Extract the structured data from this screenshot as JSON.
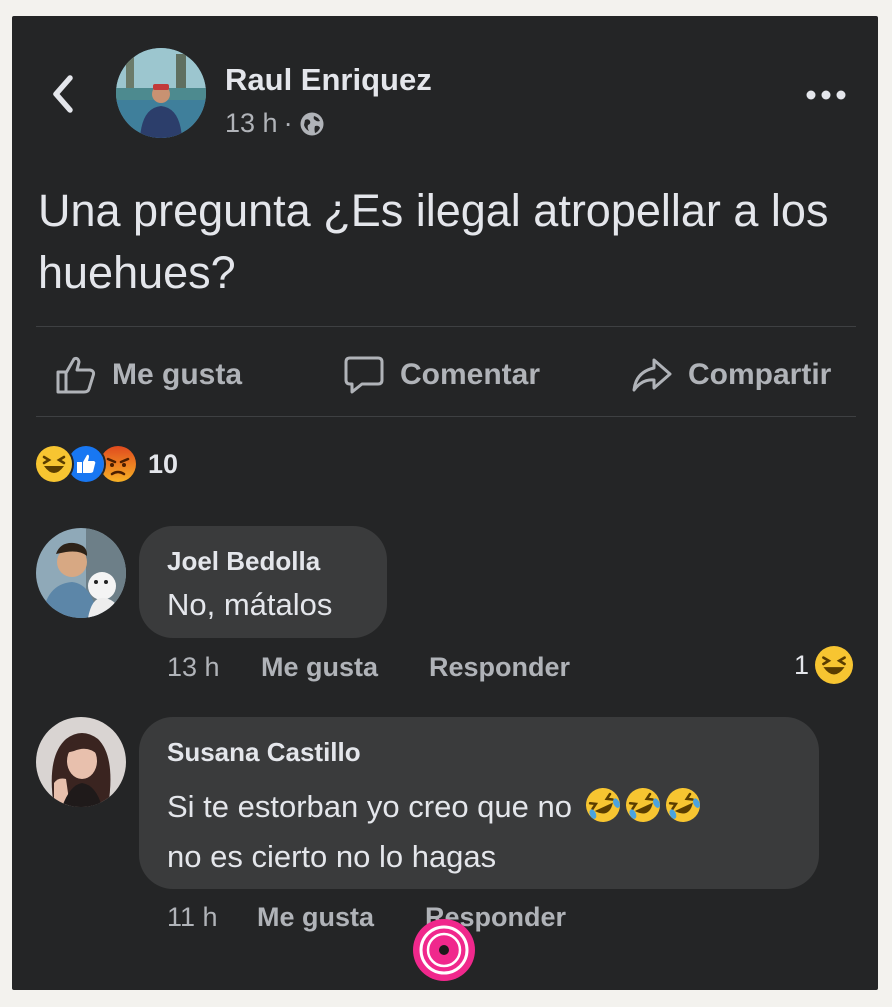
{
  "post": {
    "author": "Raul Enriquez",
    "time": "13 h",
    "separator": "·",
    "text": "Una pregunta ¿Es ilegal atropellar a los huehues?",
    "reaction_count": "10"
  },
  "actions": {
    "like": "Me gusta",
    "comment": "Comentar",
    "share": "Compartir"
  },
  "comments": [
    {
      "name": "Joel Bedolla",
      "text": "No, mátalos",
      "time": "13 h",
      "like": "Me gusta",
      "reply": "Responder",
      "reaction_count": "1"
    },
    {
      "name": "Susana Castillo",
      "text_line1": "Si te estorban yo creo que no",
      "text_line2": "no es cierto no lo hagas",
      "time": "11 h",
      "like": "Me gusta",
      "reply": "Responder"
    }
  ],
  "icons": {
    "back": "chevron-left-icon",
    "more": "more-dots-icon",
    "privacy": "globe-icon",
    "like": "thumbs-up-icon",
    "comment": "speech-bubble-icon",
    "share": "share-arrow-icon",
    "laugh": "laughing-emoji",
    "like_reaction": "like-reaction",
    "angry": "angry-emoji",
    "rofl": "rolling-laughing-emoji"
  },
  "colors": {
    "background": "#242526",
    "bubble": "#3a3b3c",
    "text_primary": "#e4e6eb",
    "text_secondary": "#b0b3b8",
    "like_blue": "#1877f2",
    "emoji_yellow": "#f7c531",
    "record_pink": "#f0288c"
  }
}
